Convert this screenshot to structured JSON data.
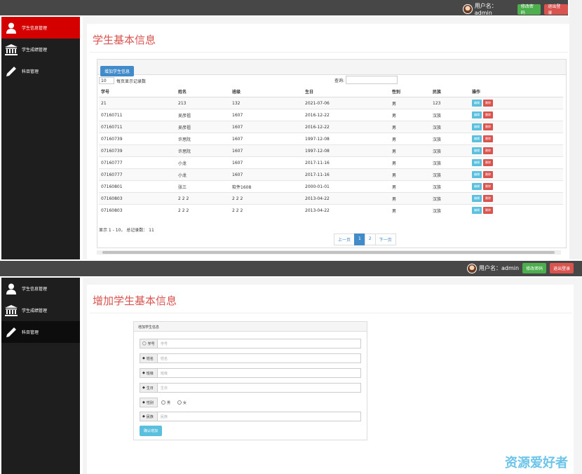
{
  "top": {
    "user_label": "用户名：admin",
    "change_pwd": "修改密码",
    "logout": "退出登录"
  },
  "sidebar": {
    "items": [
      {
        "label": "学生信息管理",
        "icon": "user-icon"
      },
      {
        "label": "学生成绩管理",
        "icon": "bank-icon"
      },
      {
        "label": "科目管理",
        "icon": "pencil-icon"
      }
    ]
  },
  "list_page": {
    "title": "学生基本信息",
    "add_button": "增加学生信息",
    "page_size": "10",
    "page_size_label": "每页显示记录数",
    "search_label": "查询:",
    "columns": [
      "学号",
      "姓名",
      "班级",
      "生日",
      "性别",
      "民族",
      "操作"
    ],
    "rows": [
      [
        "21",
        "213",
        "132",
        "2021-07-06",
        "男",
        "123"
      ],
      [
        "07160711",
        "吴彦祖",
        "1607",
        "2016-12-22",
        "男",
        "汉族"
      ],
      [
        "07160711",
        "吴彦祖",
        "1607",
        "2016-12-22",
        "男",
        "汉族"
      ],
      [
        "07160739",
        "许思阮",
        "1607",
        "1997-12-08",
        "男",
        "汉族"
      ],
      [
        "07160739",
        "许思阮",
        "1607",
        "1997-12-08",
        "男",
        "汉族"
      ],
      [
        "07160777",
        "小龙",
        "1607",
        "2017-11-16",
        "男",
        "汉族"
      ],
      [
        "07160777",
        "小龙",
        "1607",
        "2017-11-16",
        "男",
        "汉族"
      ],
      [
        "07160801",
        "张三",
        "软件1608",
        "2000-01-01",
        "男",
        "汉族"
      ],
      [
        "07160803",
        "2 2 2",
        "2 2 2",
        "2013-04-22",
        "男",
        "汉族"
      ],
      [
        "07160803",
        "2 2 2",
        "2 2 2",
        "2013-04-22",
        "男",
        "汉族"
      ]
    ],
    "edit_label": "编辑",
    "delete_label": "删除",
    "info": "显示 1 - 10， 总记录数： 11",
    "pager": {
      "prev": "上一页",
      "pages": [
        "1",
        "2"
      ],
      "next": "下一页"
    }
  },
  "add_page": {
    "title": "增加学生基本信息",
    "panel_title": "增加学生信息",
    "fields": [
      {
        "label": "学号",
        "placeholder": "学号"
      },
      {
        "label": "姓名",
        "placeholder": "姓名"
      },
      {
        "label": "班级",
        "placeholder": "班级"
      },
      {
        "label": "生日",
        "placeholder": "生日"
      }
    ],
    "gender_label": "性别",
    "gender_options": [
      "男",
      "女"
    ],
    "nation": {
      "label": "民族",
      "placeholder": "民族"
    },
    "submit": "确认增加"
  },
  "watermark": "资源爱好者"
}
